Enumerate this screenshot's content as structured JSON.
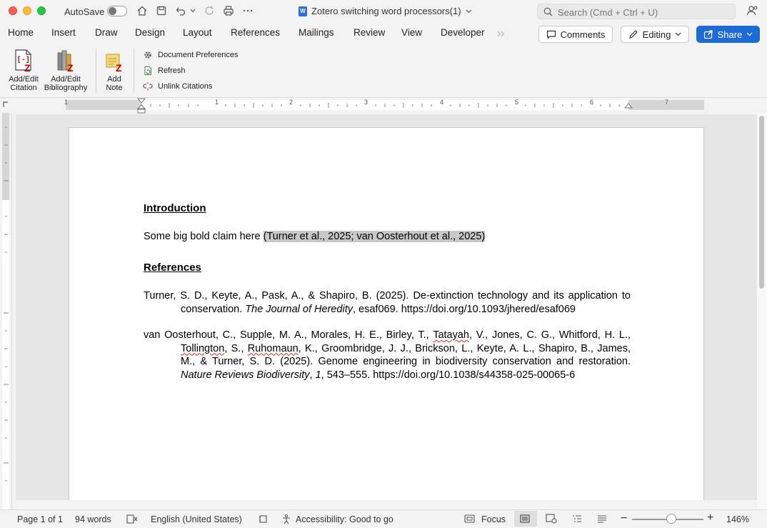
{
  "window": {
    "autosave_label": "AutoSave",
    "doc_title": "Zotero switching word processors(1)",
    "search_placeholder": "Search (Cmd + Ctrl + U)"
  },
  "tabs": [
    "Home",
    "Insert",
    "Draw",
    "Design",
    "Layout",
    "References",
    "Mailings",
    "Review",
    "View",
    "Developer"
  ],
  "header_buttons": {
    "comments": "Comments",
    "editing": "Editing",
    "share": "Share"
  },
  "ribbon": {
    "add_edit_citation": [
      "Add/Edit",
      "Citation"
    ],
    "add_edit_bibliography": [
      "Add/Edit",
      "Bibliography"
    ],
    "add_note": [
      "Add",
      "Note"
    ],
    "document_preferences": "Document Preferences",
    "refresh": "Refresh",
    "unlink_citations": "Unlink Citations"
  },
  "ruler_numbers": [
    "1",
    "1",
    "2",
    "3",
    "4",
    "5",
    "6",
    "7"
  ],
  "document": {
    "heading_intro": "Introduction",
    "claim_text": "Some big bold claim here ",
    "citation": "(Turner et al., 2025; van Oosterhout et al., 2025)",
    "heading_refs": "References",
    "ref1": {
      "a": "Turner, S. D., Keyte, A., Pask, A., & Shapiro, B. (2025). De-extinction technology and its application to conservation. ",
      "journal": "The Journal of Heredity",
      "b": ", esaf069. https://doi.org/10.1093/jhered/esaf069"
    },
    "ref2": {
      "a": "van Oosterhout, C., Supple, M. A., Morales, H. E., Birley, T., ",
      "s1": "Tatayah",
      "b": ", V., Jones, C. G., Whitford, H. L., ",
      "s2": "Tollington",
      "c": ", S., ",
      "s3": "Ruhomaun",
      "d": ", K., Groombridge, J. J., Brickson, L., Keyte, A. L., Shapiro, B., James, M., & Turner, S. D. (2025). Genome engineering in biodiversity conservation and restoration. ",
      "journal": "Nature Reviews Biodiversity",
      "e": ", ",
      "vol": "1",
      "f": ", 543–555. https://doi.org/10.1038/s44358-025-00065-6"
    }
  },
  "status": {
    "page": "Page 1 of 1",
    "words": "94 words",
    "language": "English (United States)",
    "accessibility": "Accessibility: Good to go",
    "focus": "Focus",
    "zoom": "146%",
    "zoom_level_fraction": 0.55
  }
}
